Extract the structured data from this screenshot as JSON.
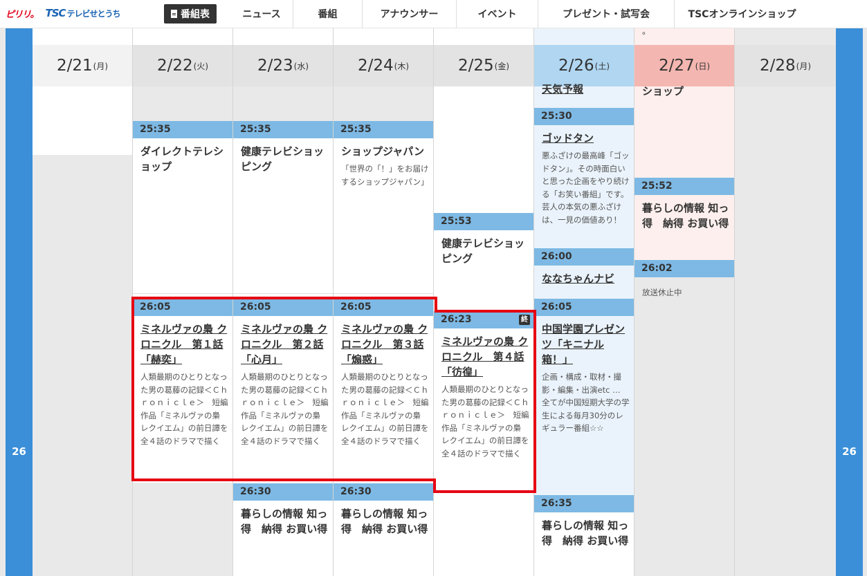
{
  "header": {
    "logo_text": "ピリリ。",
    "logo_tsc": "TSC",
    "logo_tsc_sub": "テレビせとうち",
    "nav": [
      "番組表",
      "ニュース",
      "番組",
      "アナウンサー",
      "イベント",
      "プレゼント・試写会",
      "TSCオンラインショップ"
    ]
  },
  "hour": "26",
  "days": [
    {
      "date": "2/21",
      "wd": "(月)"
    },
    {
      "date": "2/22",
      "wd": "(火)"
    },
    {
      "date": "2/23",
      "wd": "(水)"
    },
    {
      "date": "2/24",
      "wd": "(木)"
    },
    {
      "date": "2/25",
      "wd": "(金)"
    },
    {
      "date": "2/26",
      "wd": "(土)"
    },
    {
      "date": "2/27",
      "wd": "(日)"
    },
    {
      "date": "2/28",
      "wd": "(月)"
    }
  ],
  "fragments": {
    "top_sat": "天気予報",
    "top_sun": "ショップ",
    "top_sun_dot": "。"
  },
  "programs": {
    "c22_1": {
      "time": "25:35",
      "title": "ダイレクトテレショップ"
    },
    "c22_2": {
      "time": "26:05",
      "title": "ミネルヴァの梟 クロニクル　第１話「赫奕」",
      "desc": "人類最期のひとりとなった男の葛藤の記録＜Ｃｈｒｏｎｉｃｌｅ＞　短編作品「ミネルヴァの梟 レクイエム」の前日譚を全４話のドラマで描く"
    },
    "c23_1": {
      "time": "25:35",
      "title": "健康テレビショッピング"
    },
    "c23_2": {
      "time": "26:05",
      "title": "ミネルヴァの梟 クロニクル　第２話「心月」",
      "desc": "人類最期のひとりとなった男の葛藤の記録＜Ｃｈｒｏｎｉｃｌｅ＞　短編作品「ミネルヴァの梟 レクイエム」の前日譚を全４話のドラマで描く"
    },
    "c23_3": {
      "time": "26:30",
      "title": "暮らしの情報 知っ得　納得 お買い得"
    },
    "c24_1": {
      "time": "25:35",
      "title": "ショップジャパン",
      "desc": "「世界の「！」をお届けするショップジャパン」"
    },
    "c24_2": {
      "time": "26:05",
      "title": "ミネルヴァの梟 クロニクル　第３話「煽惑」",
      "desc": "人類最期のひとりとなった男の葛藤の記録＜Ｃｈｒｏｎｉｃｌｅ＞　短編作品「ミネルヴァの梟 レクイエム」の前日譚を全４話のドラマで描く"
    },
    "c24_3": {
      "time": "26:30",
      "title": "暮らしの情報 知っ得　納得 お買い得"
    },
    "c25_1": {
      "time": "25:53",
      "title": "健康テレビショッピング"
    },
    "c25_2": {
      "time": "26:23",
      "badge": "終",
      "title": "ミネルヴァの梟 クロニクル　第４話「彷徨」",
      "desc": "人類最期のひとりとなった男の葛藤の記録＜Ｃｈｒｏｎｉｃｌｅ＞　短編作品「ミネルヴァの梟 レクイエム」の前日譚を全４話のドラマで描く"
    },
    "c26_1": {
      "time": "25:30",
      "title": "ゴッドタン",
      "desc": "悪ふざけの最高峰「ゴッドタン」。その時面白いと思った企画をやり続ける「お笑い番組」です。芸人の本気の悪ふざけは、一見の価値あり！"
    },
    "c26_2": {
      "time": "26:00",
      "title": "ななちゃんナビ"
    },
    "c26_3": {
      "time": "26:05",
      "title": "中国学園プレゼンツ「キニナル箱！」",
      "desc": "企画・構成・取材・撮影・編集・出演etc … 全てが中国短期大学の学生による毎月30分のレギュラー番組☆☆"
    },
    "c26_4": {
      "time": "26:35",
      "title": "暮らしの情報 知っ得　納得 お買い得"
    },
    "c27_1": {
      "time": "25:52",
      "title": "暮らしの情報 知っ得　納得 お買い得"
    },
    "c27_2": {
      "time": "26:02",
      "desc": "放送休止中"
    }
  }
}
